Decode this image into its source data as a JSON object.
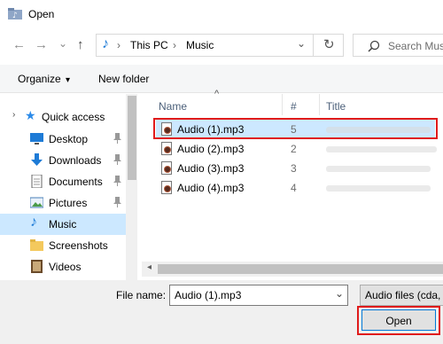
{
  "window": {
    "title": "Open"
  },
  "nav": {
    "back_glyph": "←",
    "forward_glyph": "→",
    "dropdown_glyph": "⌄",
    "up_glyph": "↑"
  },
  "address": {
    "segments": [
      "This PC",
      "Music"
    ],
    "separator": "›",
    "dropdown_glyph": "⌄",
    "refresh_glyph": "↻"
  },
  "search": {
    "placeholder": "Search Mus"
  },
  "toolbar": {
    "organize_label": "Organize",
    "organize_arrow": "▾",
    "new_folder_label": "New folder"
  },
  "sidebar": {
    "items": [
      {
        "label": "Quick access",
        "icon": "star-icon"
      },
      {
        "label": "Desktop",
        "icon": "desktop-icon",
        "pinned": true
      },
      {
        "label": "Downloads",
        "icon": "download-icon",
        "pinned": true
      },
      {
        "label": "Documents",
        "icon": "document-icon",
        "pinned": true
      },
      {
        "label": "Pictures",
        "icon": "pictures-icon",
        "pinned": true
      },
      {
        "label": "Music",
        "icon": "music-note-icon",
        "selected": true
      },
      {
        "label": "Screenshots",
        "icon": "folder-icon"
      },
      {
        "label": "Videos",
        "icon": "videos-icon"
      }
    ]
  },
  "columns": {
    "name": "Name",
    "number": "#",
    "title": "Title",
    "sort_glyph": "^"
  },
  "files": [
    {
      "name": "Audio (1).mp3",
      "number": "5",
      "selected": true
    },
    {
      "name": "Audio (2).mp3",
      "number": "2"
    },
    {
      "name": "Audio (3).mp3",
      "number": "3"
    },
    {
      "name": "Audio (4).mp3",
      "number": "4"
    }
  ],
  "bottom": {
    "filename_label": "File name:",
    "filename_value": "Audio (1).mp3",
    "filter_value": "Audio files (cda, v",
    "open_label": "Open"
  },
  "colors": {
    "accent": "#0078d7",
    "highlight": "#e01b1b",
    "selection": "#cce8ff"
  }
}
